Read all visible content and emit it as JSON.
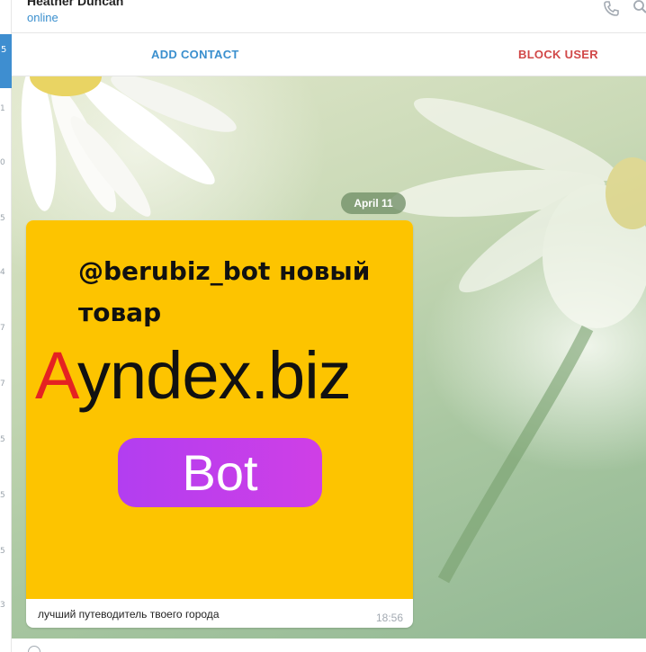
{
  "header": {
    "contact_name": "Heather Duncan",
    "status": "online",
    "call_icon": "phone-icon",
    "search_icon": "search-icon"
  },
  "actions": {
    "add_contact": "ADD CONTACT",
    "block_user": "BLOCK USER"
  },
  "chat": {
    "date": "April 11",
    "message": {
      "media": {
        "line1": "@berubiz_bot новый",
        "line2": "товар",
        "brand_first": "A",
        "brand_rest": "yndex.biz",
        "button": "Bot"
      },
      "caption": "лучший путеводитель твоего города",
      "time": "18:56"
    }
  },
  "colors": {
    "accent": "#3a8fce",
    "danger": "#d14848",
    "media_bg": "#fdc400",
    "bot_pill": "#b23ef0"
  }
}
